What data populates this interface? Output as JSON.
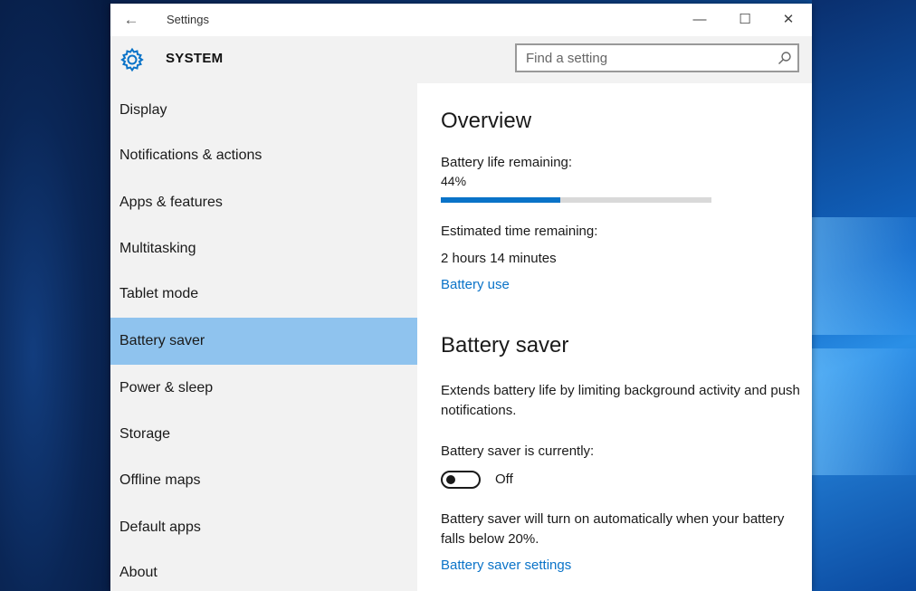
{
  "window": {
    "title": "Settings",
    "back_icon": "back-arrow-icon",
    "minimize_glyph": "—",
    "maximize_glyph": "☐",
    "close_glyph": "✕"
  },
  "header": {
    "icon": "gear-icon",
    "section_title": "SYSTEM",
    "search_placeholder": "Find a setting"
  },
  "sidebar": {
    "items": [
      {
        "label": "Display"
      },
      {
        "label": "Notifications & actions"
      },
      {
        "label": "Apps & features"
      },
      {
        "label": "Multitasking"
      },
      {
        "label": "Tablet mode"
      },
      {
        "label": "Battery saver",
        "selected": true
      },
      {
        "label": "Power & sleep"
      },
      {
        "label": "Storage"
      },
      {
        "label": "Offline maps"
      },
      {
        "label": "Default apps"
      },
      {
        "label": "About"
      }
    ]
  },
  "overview": {
    "heading": "Overview",
    "battery_label": "Battery life remaining:",
    "battery_percent_text": "44%",
    "battery_level": 0.44,
    "estimated_label": "Estimated time remaining:",
    "estimated_value": "2 hours 14 minutes",
    "battery_use_link": "Battery use"
  },
  "battery_saver": {
    "heading": "Battery saver",
    "description": "Extends battery life by limiting background activity and push notifications.",
    "status_label": "Battery saver is currently:",
    "toggle_state": "Off",
    "auto_text": "Battery saver will turn on automatically when your battery falls below 20%.",
    "settings_link": "Battery saver settings"
  },
  "colors": {
    "accent": "#0a73c8",
    "selected_nav": "#8fc3ee",
    "sidebar_bg": "#f2f2f2"
  }
}
